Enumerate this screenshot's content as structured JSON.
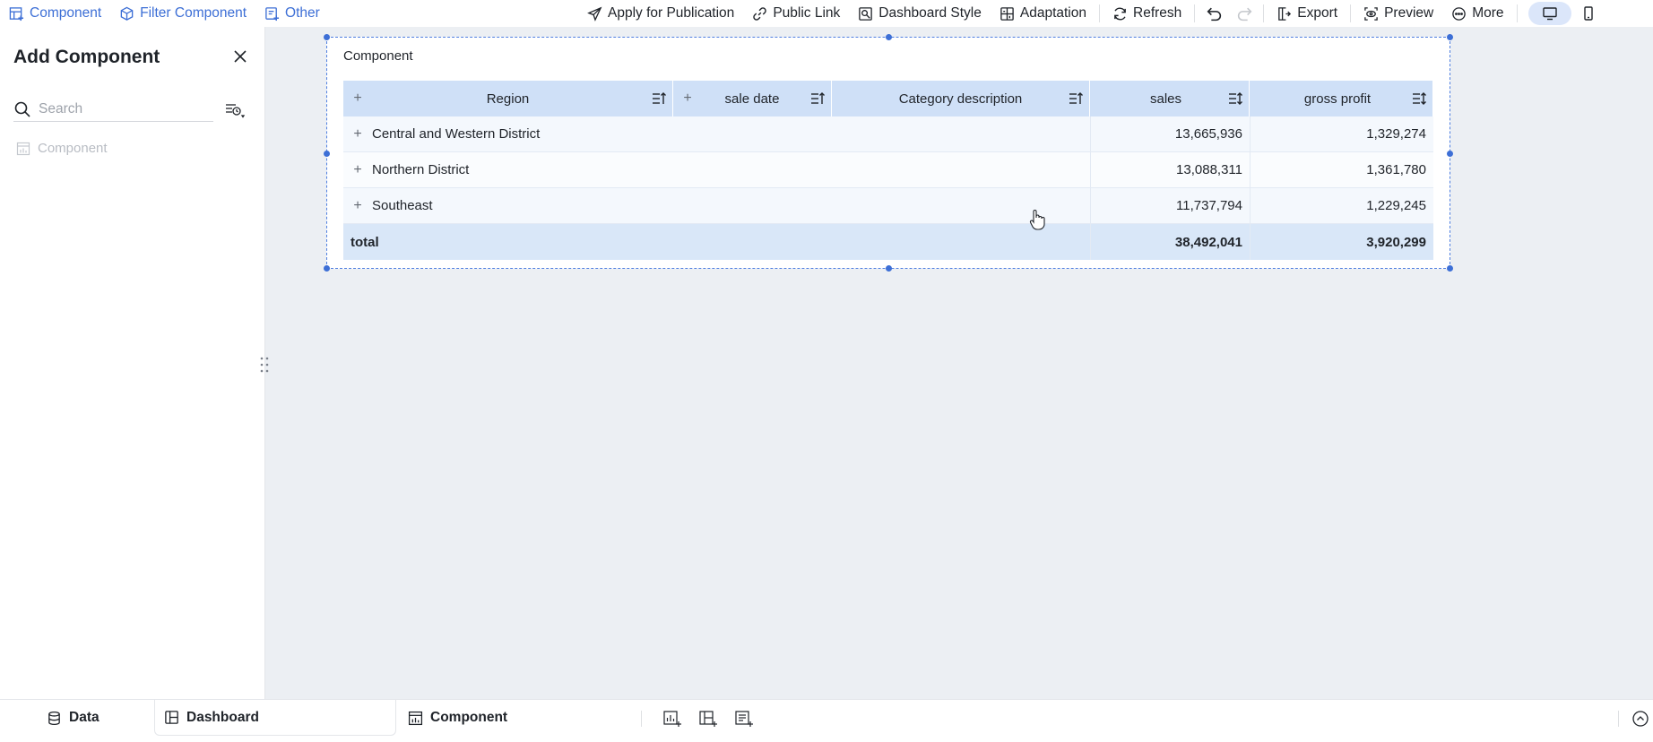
{
  "toolbar": {
    "left": [
      {
        "label": "Component",
        "icon": "table-add-icon"
      },
      {
        "label": "Filter Component",
        "icon": "filter-cube-icon"
      },
      {
        "label": "Other",
        "icon": "other-add-icon"
      }
    ],
    "right": {
      "apply_publication": "Apply for Publication",
      "public_link": "Public Link",
      "dashboard_style": "Dashboard Style",
      "adaptation": "Adaptation",
      "refresh": "Refresh",
      "export": "Export",
      "preview": "Preview",
      "more": "More"
    },
    "accent_color": "#3d6fd6"
  },
  "panel": {
    "title": "Add Component",
    "search_placeholder": "Search",
    "items": [
      {
        "label": "Component",
        "icon": "chart-table-icon"
      }
    ]
  },
  "component": {
    "title": "Component",
    "columns": {
      "region": "Region",
      "sale_date": "sale date",
      "category": "Category description",
      "sales": "sales",
      "gross_profit": "gross profit"
    },
    "rows": [
      {
        "region": "Central and Western District",
        "sales": "13,665,936",
        "gross_profit": "1,329,274"
      },
      {
        "region": "Northern District",
        "sales": "13,088,311",
        "gross_profit": "1,361,780"
      },
      {
        "region": "Southeast",
        "sales": "11,737,794",
        "gross_profit": "1,229,245"
      }
    ],
    "total": {
      "label": "total",
      "sales": "38,492,041",
      "gross_profit": "3,920,299"
    }
  },
  "bottom": {
    "tabs": [
      {
        "label": "Data",
        "icon": "database-icon"
      },
      {
        "label": "Dashboard",
        "icon": "dashboard-icon",
        "active": true
      },
      {
        "label": "Component",
        "icon": "chart-table-icon"
      }
    ]
  }
}
